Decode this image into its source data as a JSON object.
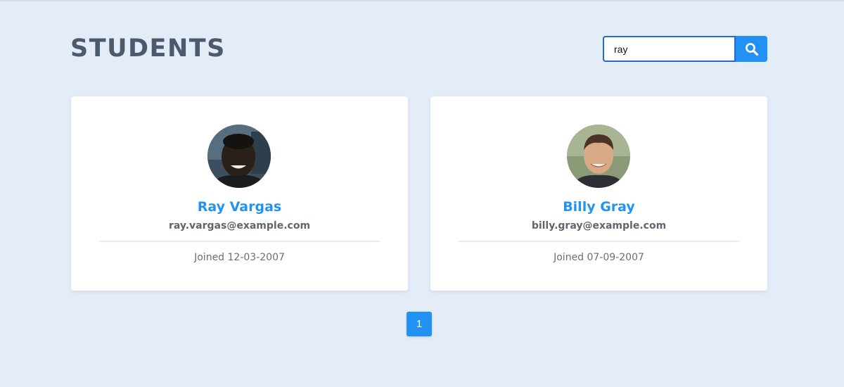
{
  "header": {
    "title": "STUDENTS"
  },
  "search": {
    "value": "ray",
    "icon": "search-icon"
  },
  "students": [
    {
      "name": "Ray Vargas",
      "email": "ray.vargas@example.com",
      "joined": "Joined 12-03-2007"
    },
    {
      "name": "Billy Gray",
      "email": "billy.gray@example.com",
      "joined": "Joined 07-09-2007"
    }
  ],
  "pagination": {
    "pages": [
      "1"
    ],
    "current": "1"
  },
  "colors": {
    "accent": "#2192f3",
    "background": "#e3ecf7",
    "title": "#4d5a6e"
  }
}
